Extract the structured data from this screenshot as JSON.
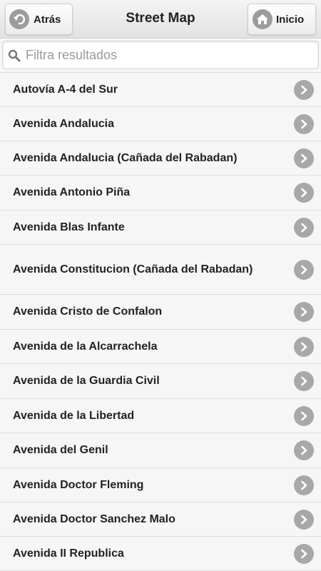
{
  "header": {
    "title": "Street Map",
    "back_label": "Atrás",
    "home_label": "Inicio"
  },
  "search": {
    "placeholder": "Filtra resultados",
    "value": ""
  },
  "items": [
    "Autovía A-4 del Sur",
    "Avenida Andalucia",
    "Avenida Andalucia (Cañada del Rabadan)",
    "Avenida Antonio Piña",
    "Avenida Blas Infante",
    "Avenida Constitucion (Cañada del Rabadan)",
    "Avenida Cristo de Confalon",
    "Avenida de la Alcarrachela",
    "Avenida de la Guardia Civil",
    "Avenida de la Libertad",
    "Avenida del Genil",
    "Avenida Doctor Fleming",
    "Avenida Doctor Sanchez Malo",
    "Avenida II Republica"
  ],
  "icons": {
    "back": "back-arrow-icon",
    "home": "home-icon",
    "search": "search-icon",
    "row": "chevron-right-icon"
  },
  "colors": {
    "icon_grey": "#a8a8a8",
    "header_bg": "#e2e2e2"
  }
}
